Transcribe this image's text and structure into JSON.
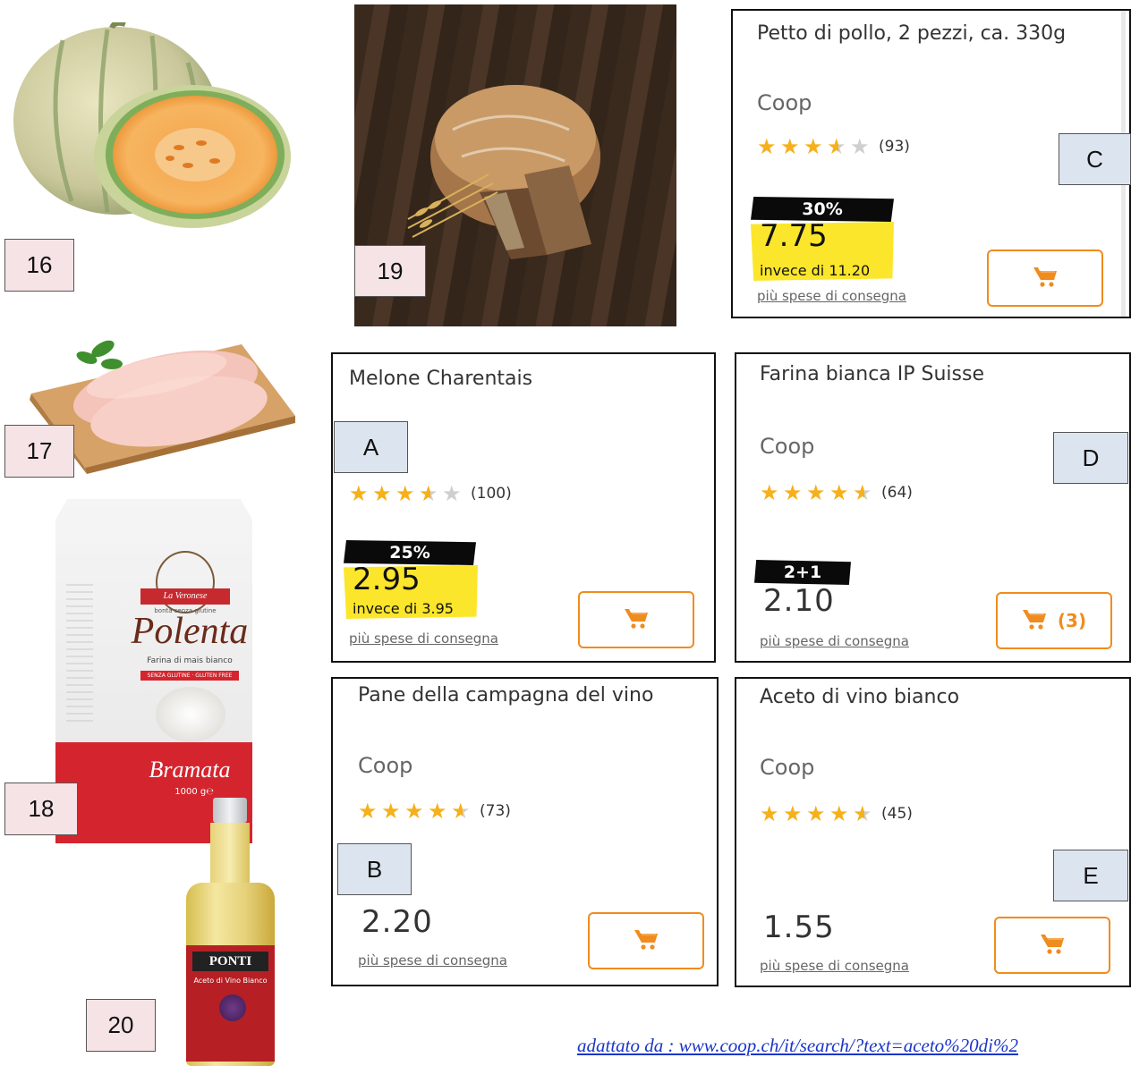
{
  "images": {
    "melon": "cantaloupe-melon-photo",
    "chicken": "chicken-breast-on-board-photo",
    "flour": "polenta-flour-bag-photo",
    "bread": "country-bread-photo",
    "vinegar": "vinegar-bottle-photo"
  },
  "image_labels": {
    "flour_brand": "La Veronese",
    "flour_small": "bontà senza glutine",
    "flour_name": "Polenta",
    "flour_sub": "Farina di mais bianco",
    "flour_strip": "SENZA GLUTINE · GLUTEN FREE",
    "flour_type": "Bramata",
    "flour_weight": "1000 g℮",
    "vinegar_brand": "PONTI",
    "vinegar_sub": "Aceto di Vino Bianco"
  },
  "numbers": {
    "n16": "16",
    "n17": "17",
    "n18": "18",
    "n19": "19",
    "n20": "20"
  },
  "letters": {
    "A": "A",
    "B": "B",
    "C": "C",
    "D": "D",
    "E": "E"
  },
  "cards": {
    "melone": {
      "title": "Melone Charentais",
      "rating": 3.5,
      "count": "(100)",
      "badge": "25%",
      "price": "2.95",
      "was": "invece di 3.95",
      "delivery": "più spese di consegna"
    },
    "pollo": {
      "title": "Petto di pollo, 2 pezzi, ca. 330g",
      "brand": "Coop",
      "rating": 3.5,
      "count": "(93)",
      "badge": "30%",
      "price": "7.75",
      "was": "invece di 11.20",
      "delivery": "più spese di consegna"
    },
    "farina": {
      "title": "Farina bianca IP Suisse",
      "brand": "Coop",
      "rating": 4.5,
      "count": "(64)",
      "badge": "2+1",
      "price": "2.10",
      "cart_qty": "(3)",
      "delivery": "più spese di consegna"
    },
    "pane": {
      "title": "Pane della campagna del vino",
      "brand": "Coop",
      "rating": 4.5,
      "count": "(73)",
      "price": "2.20",
      "delivery": "più spese di consegna"
    },
    "aceto": {
      "title": "Aceto di vino bianco",
      "brand": "Coop",
      "rating": 4.5,
      "count": "(45)",
      "price": "1.55",
      "delivery": "più spese di consegna"
    }
  },
  "source": "adattato da : www.coop.ch/it/search/?text=aceto%20di%2",
  "colors": {
    "star": "#f6b01a",
    "cart": "#f08c1e",
    "sale": "#fbe62b"
  }
}
